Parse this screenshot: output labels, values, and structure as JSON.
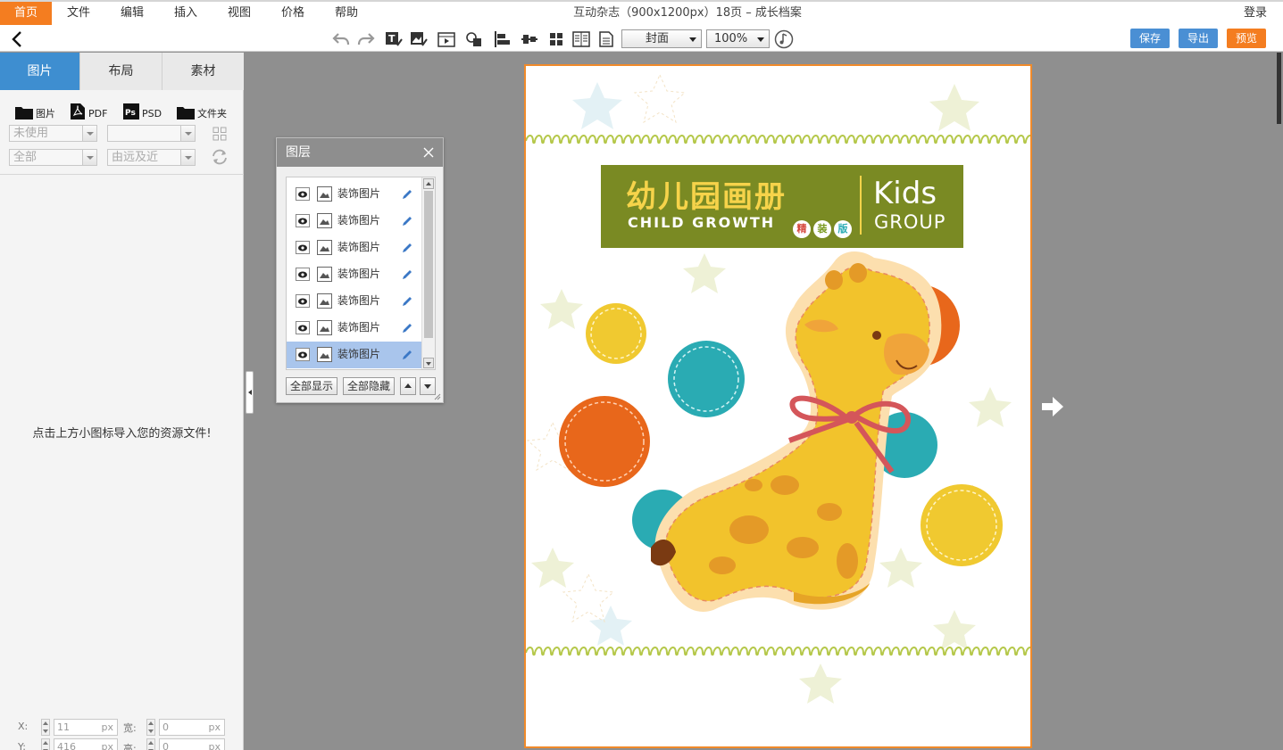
{
  "menu": {
    "items": [
      "首页",
      "文件",
      "编辑",
      "插入",
      "视图",
      "价格",
      "帮助"
    ],
    "active_index": 0,
    "doc_title": "互动杂志（900x1200px）18页 – 成长档案",
    "login": "登录"
  },
  "toolbar": {
    "icons": [
      "undo-icon",
      "redo-icon",
      "text-edit-icon",
      "image-edit-icon",
      "video-icon",
      "shape-icon",
      "align-left-icon",
      "distribute-icon",
      "grid-view-icon",
      "two-page-icon",
      "single-page-icon",
      "music-icon"
    ],
    "page_select": "封面",
    "zoom_select": "100%",
    "save_label": "保存",
    "export_label": "导出",
    "preview_label": "预览"
  },
  "left_panel": {
    "tabs": [
      "图片",
      "布局",
      "素材"
    ],
    "active_tab": 0,
    "import": {
      "image_label": "图片",
      "pdf_label": "PDF",
      "psd_label": "PSD",
      "folder_label": "文件夹"
    },
    "filter1": "未使用",
    "filter2": "",
    "filter3": "全部",
    "filter4": "由远及近",
    "hint": "点击上方小图标导入您的资源文件!",
    "coords": {
      "x_label": "X:",
      "x_value": "11",
      "y_label": "Y:",
      "y_value": "416",
      "w_label": "宽:",
      "w_value": "0",
      "h_label": "高:",
      "h_value": "0",
      "unit": "px"
    }
  },
  "layers": {
    "title": "图层",
    "items": [
      {
        "name": "装饰图片"
      },
      {
        "name": "装饰图片"
      },
      {
        "name": "装饰图片"
      },
      {
        "name": "装饰图片"
      },
      {
        "name": "装饰图片"
      },
      {
        "name": "装饰图片"
      },
      {
        "name": "装饰图片"
      }
    ],
    "selected_index": 6,
    "show_all": "全部显示",
    "hide_all": "全部隐藏"
  },
  "canvas": {
    "title_cn": "幼儿园画册",
    "title_en": "CHILD GROWTH",
    "kids": "Kids",
    "group": "GROUP",
    "badges": [
      "精",
      "装",
      "版"
    ],
    "colors": {
      "accent": "#f47d20",
      "blue_button": "#4a8fd4",
      "banner": "#7a8a23",
      "yellow": "#f0c930",
      "teal": "#2aabb3",
      "orange": "#e8671b"
    }
  }
}
